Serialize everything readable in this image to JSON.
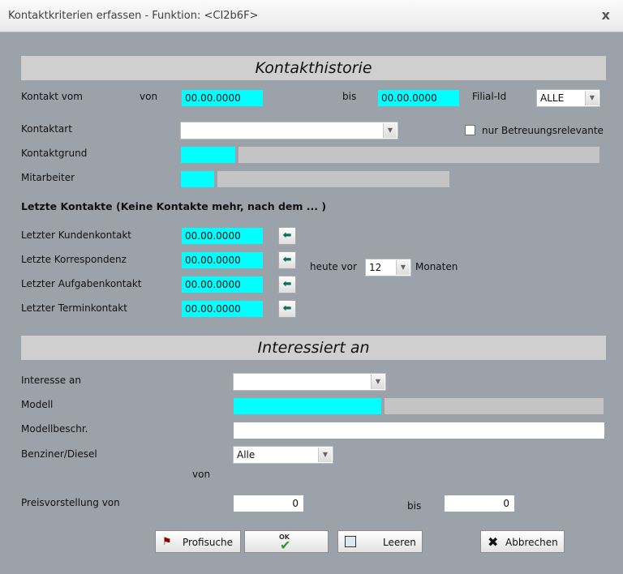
{
  "window": {
    "title": "Kontaktkriterien erfassen - Funktion: <CI2b6F>",
    "close_glyph": "x"
  },
  "kontakthistorie": {
    "header": "Kontakthistorie",
    "kontakt_vom_label": "Kontakt vom",
    "von_label": "von",
    "von_value": "00.00.0000",
    "bis_label": "bis",
    "bis_value": "00.00.0000",
    "filial_label": "Filial-Id",
    "filial_value": "ALLE",
    "kontaktart_label": "Kontaktart",
    "kontaktart_value": "",
    "nur_betreuung_label": "nur Betreuungsrelevante",
    "kontaktgrund_label": "Kontaktgrund",
    "mitarbeiter_label": "Mitarbeiter"
  },
  "letzte_kontakte": {
    "header": "Letzte Kontakte (Keine Kontakte mehr, nach dem ... )",
    "kunden_label": "Letzter Kundenkontakt",
    "kunden_value": "00.00.0000",
    "korr_label": "Letzte Korrespondenz",
    "korr_value": "00.00.0000",
    "aufgaben_label": "Letzter Aufgabenkontakt",
    "aufgaben_value": "00.00.0000",
    "termin_label": "Letzter Terminkontakt",
    "termin_value": "00.00.0000",
    "heute_vor_label": "heute vor",
    "monate_value": "12",
    "monaten_label": "Monaten"
  },
  "interessiert": {
    "header": "Interessiert an",
    "interesse_label": "Interesse an",
    "interesse_value": "",
    "modell_label": "Modell",
    "modellbeschr_label": "Modellbeschr.",
    "benziner_label": "Benziner/Diesel",
    "benziner_value": "Alle",
    "von_label": "von",
    "preis_label": "Preisvorstellung von",
    "preis_von_value": "0",
    "bis_label": "bis",
    "preis_bis_value": "0"
  },
  "buttons": {
    "profisuche": "Profisuche",
    "ok_badge": "OK",
    "leeren": "Leeren",
    "abbrechen": "Abbrechen"
  },
  "colors": {
    "dialog_bg": "#9ca2aa",
    "highlight_field": "#00ffff",
    "section_header": "#cfcfcf"
  }
}
